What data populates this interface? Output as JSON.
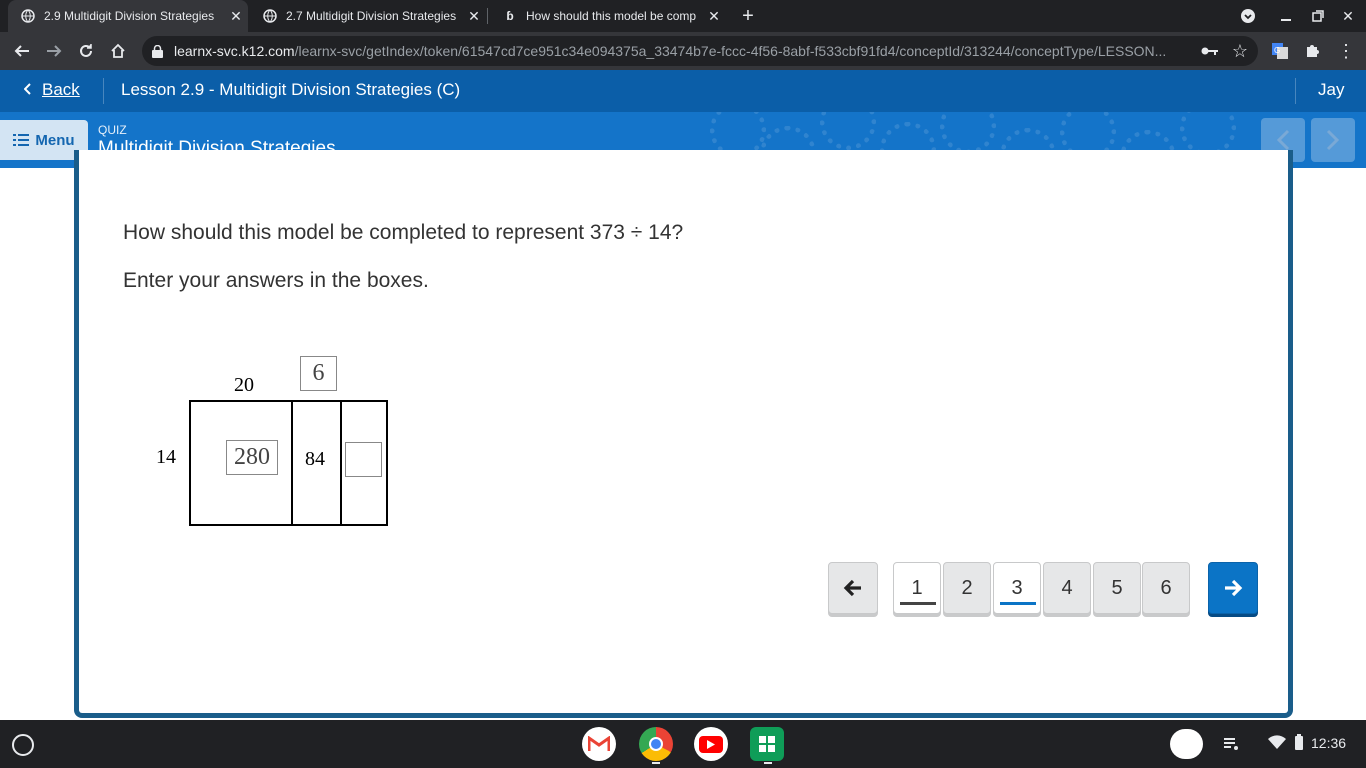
{
  "browser": {
    "tabs": [
      {
        "title": "2.9 Multidigit Division Strategies",
        "active": true
      },
      {
        "title": "2.7 Multidigit Division Strategies",
        "active": false
      },
      {
        "title": "How should this model be comp",
        "active": false
      }
    ],
    "url_host": "learnx-svc.k12.com",
    "url_path": "/learnx-svc/getIndex/token/61547cd7ce951c34e094375a_33474b7e-fccc-4f56-8abf-f533cbf91fd4/conceptId/313244/conceptType/LESSON..."
  },
  "lesson": {
    "back_label": "Back",
    "title": "Lesson 2.9 - Multidigit Division Strategies (C)",
    "user": "Jay",
    "menu_label": "Menu",
    "kind": "QUIZ",
    "quiz_title": "Multidigit Division Strategies"
  },
  "question": {
    "prompt": "How should this model be completed to represent 373 ÷ 14?",
    "instruction": "Enter your answers in the boxes."
  },
  "model": {
    "top_label_1": "20",
    "top_box_value": "6",
    "side_label": "14",
    "cell_1_value": "280",
    "cell_2_value": "84",
    "cell_3_value": ""
  },
  "pagination": {
    "pages": [
      "1",
      "2",
      "3",
      "4",
      "5",
      "6"
    ],
    "current": "3",
    "accent": "#0b74c6"
  },
  "shelf": {
    "time": "12:36"
  }
}
